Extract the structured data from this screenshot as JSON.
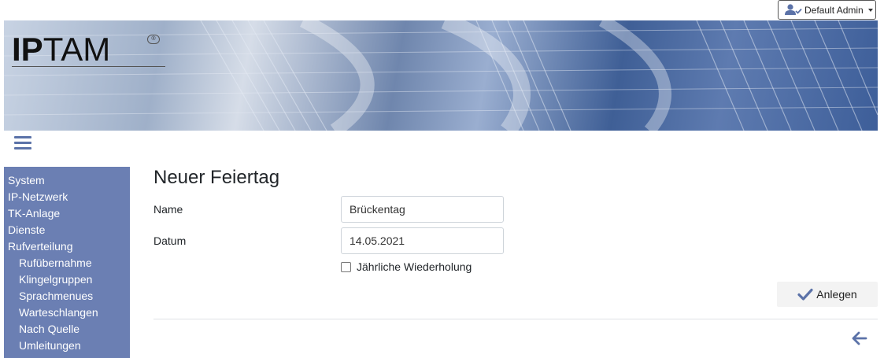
{
  "user_menu": {
    "label": "Default Admin",
    "icon": "user-check-icon"
  },
  "banner": {
    "logo_bold": "IP",
    "logo_thin": "TAM",
    "logo_mark": "®"
  },
  "sidebar": {
    "items": [
      {
        "label": "System",
        "level": 0
      },
      {
        "label": "IP-Netzwerk",
        "level": 0
      },
      {
        "label": "TK-Anlage",
        "level": 0
      },
      {
        "label": "Dienste",
        "level": 0
      },
      {
        "label": "Rufverteilung",
        "level": 0
      },
      {
        "label": "Rufübernahme",
        "level": 1
      },
      {
        "label": "Klingelgruppen",
        "level": 1
      },
      {
        "label": "Sprachmenues",
        "level": 1
      },
      {
        "label": "Warteschlangen",
        "level": 1
      },
      {
        "label": "Nach Quelle",
        "level": 1
      },
      {
        "label": "Umleitungen",
        "level": 1
      }
    ]
  },
  "form": {
    "title": "Neuer Feiertag",
    "name_label": "Name",
    "name_value": "Brückentag",
    "date_label": "Datum",
    "date_value": "14.05.2021",
    "repeat_label": "Jährliche Wiederholung",
    "repeat_checked": false,
    "submit_label": "Anlegen"
  },
  "colors": {
    "sidebar_bg": "#6b7fb3",
    "accent": "#5b72a8"
  }
}
